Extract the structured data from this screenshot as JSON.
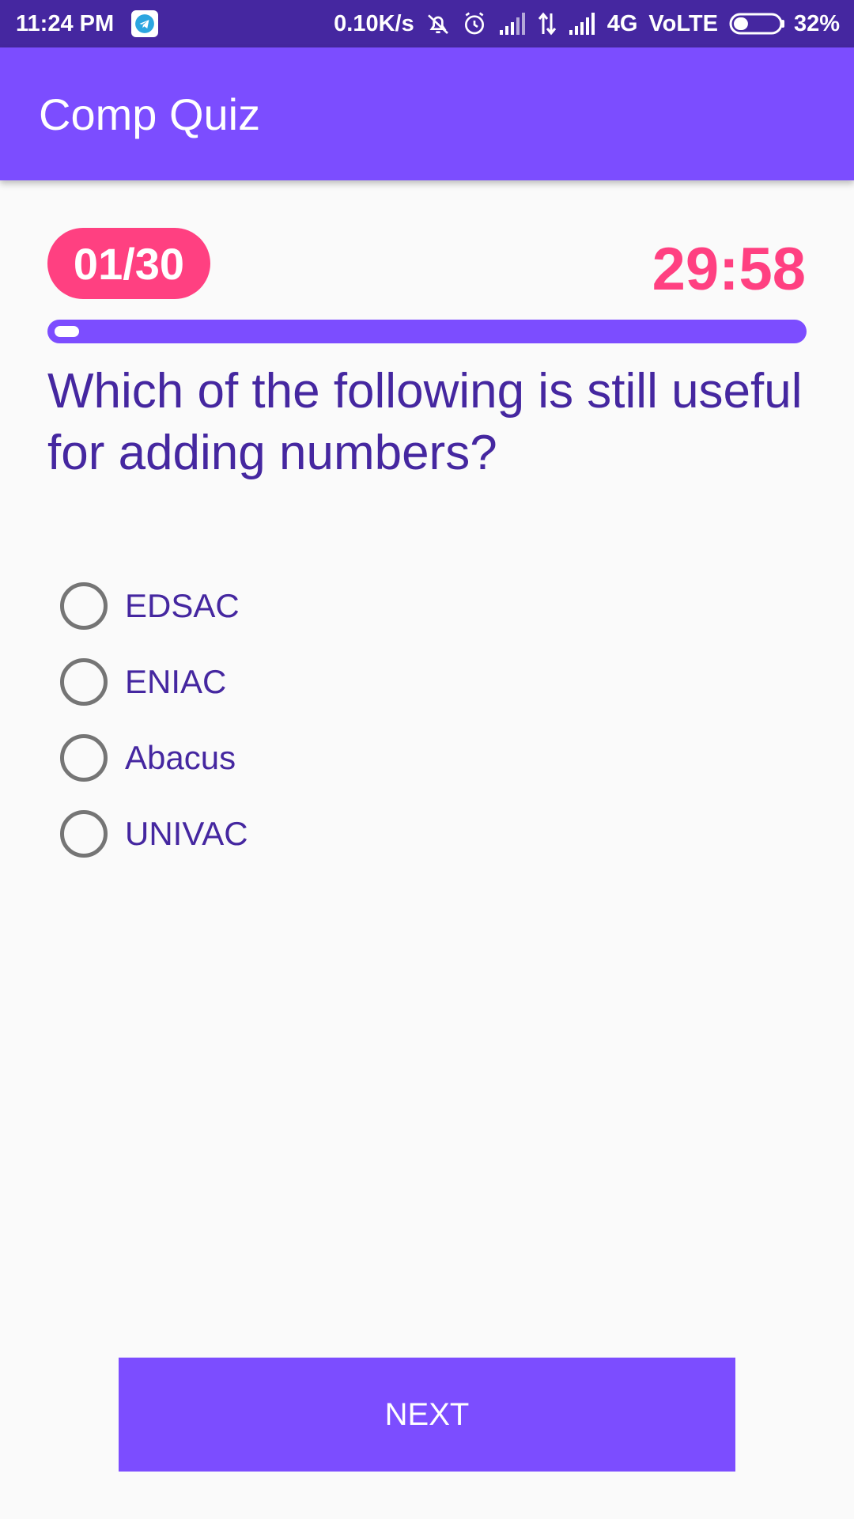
{
  "status_bar": {
    "time": "11:24 PM",
    "speed": "0.10K/s",
    "network": "4G",
    "volte": "VoLTE",
    "battery": "32%",
    "battery_level": 0.32,
    "icons": [
      "telegram-icon",
      "mute-icon",
      "alarm-icon",
      "signal-icon",
      "data-transfer-icon",
      "signal-icon",
      "battery-icon"
    ]
  },
  "app_bar": {
    "title": "Comp Quiz"
  },
  "quiz": {
    "counter": "01/30",
    "timer": "29:58",
    "progress": 0.0333,
    "question": "Which of the following is still useful for adding numbers?",
    "options": [
      "EDSAC",
      "ENIAC",
      "Abacus",
      "UNIVAC"
    ]
  },
  "next_button": {
    "label": "NEXT"
  },
  "colors": {
    "status_bar": "#4527a0",
    "primary": "#7c4dff",
    "accent": "#ff4081",
    "text_primary": "#4527a0",
    "background": "#fafafa"
  }
}
